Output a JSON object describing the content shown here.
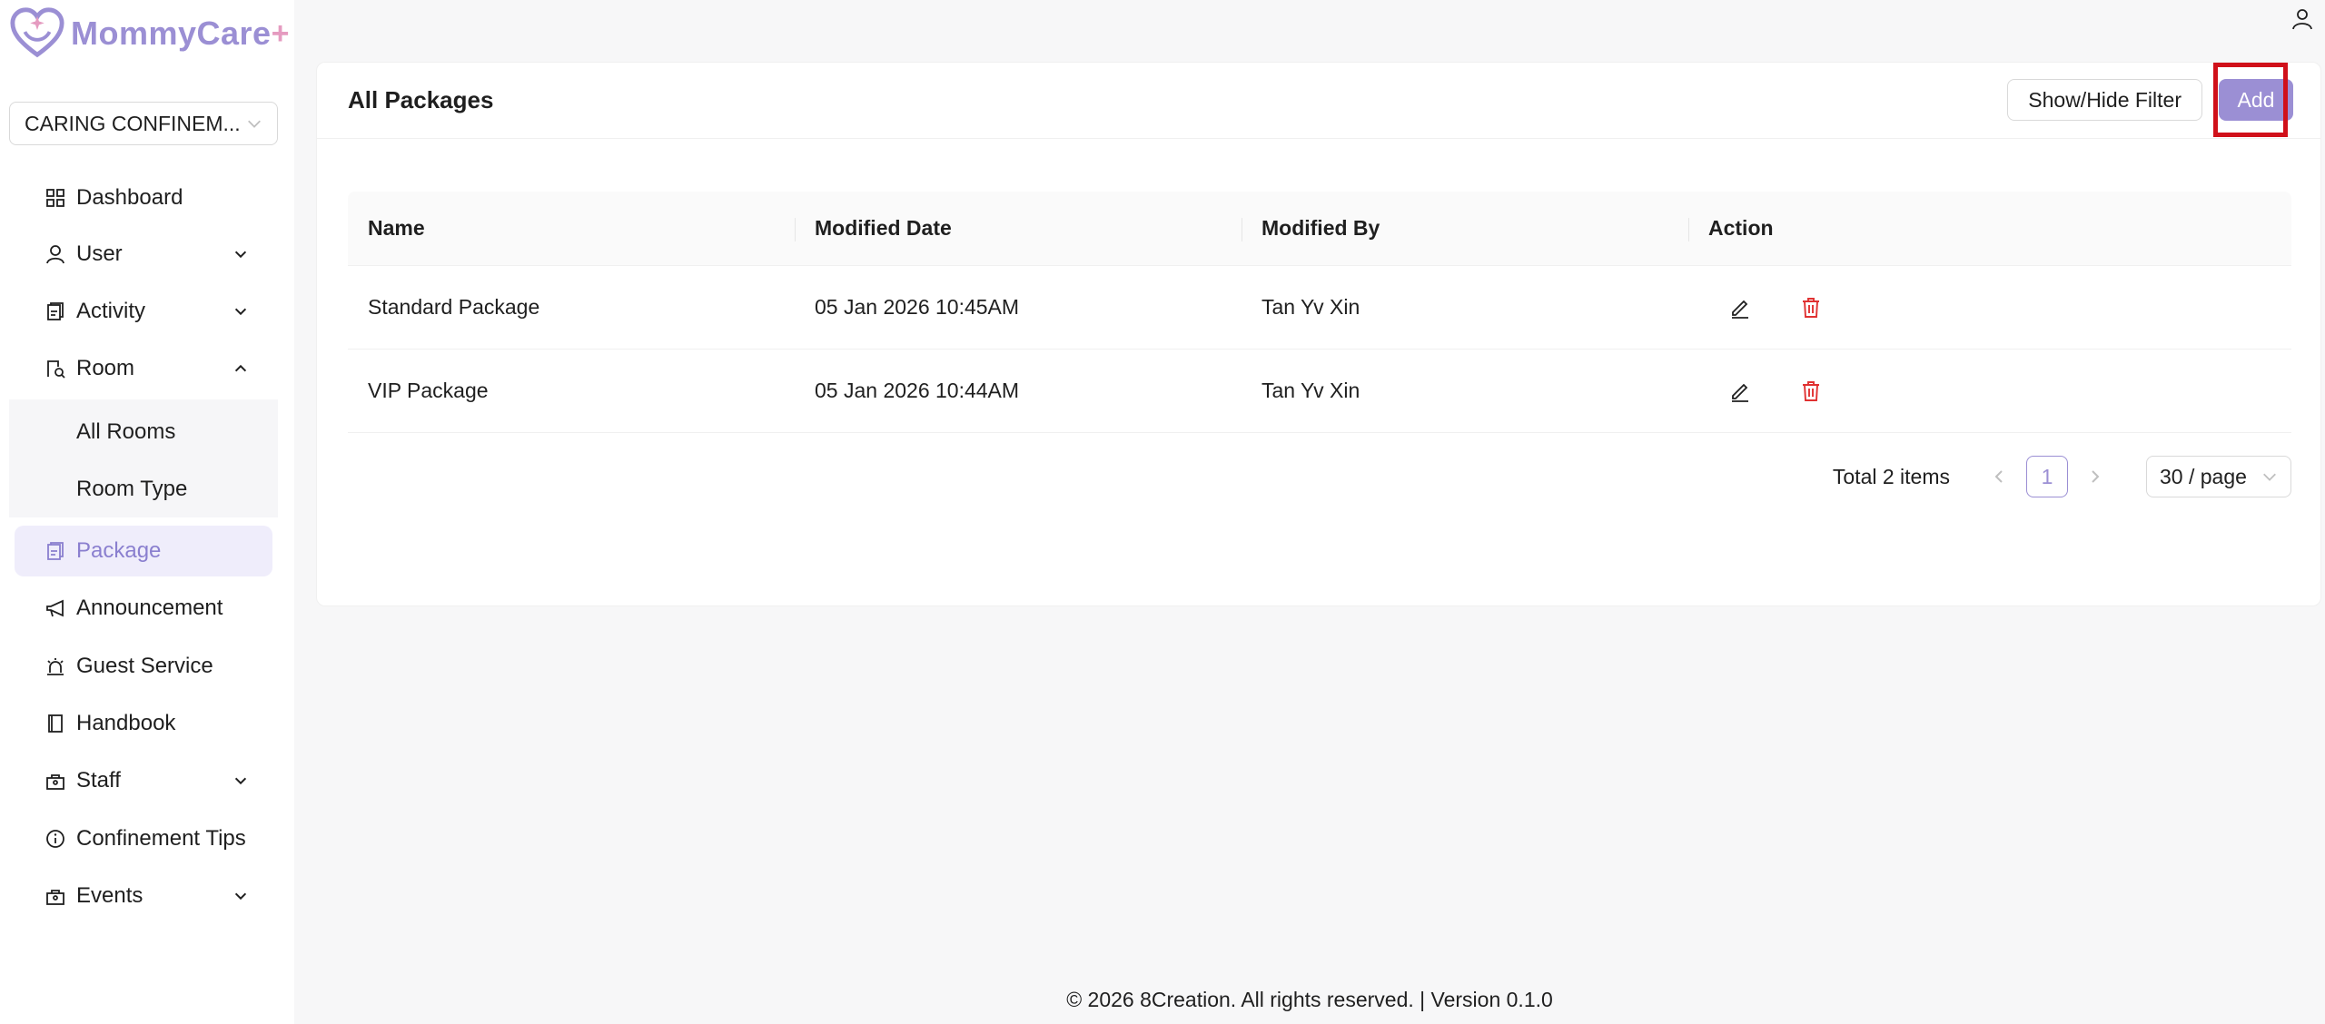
{
  "brand": {
    "name": "MommyCare",
    "plus": "+"
  },
  "org_select": {
    "value": "CARING CONFINEM..."
  },
  "sidebar": {
    "items": [
      {
        "key": "dashboard",
        "label": "Dashboard",
        "icon": "dashboard-icon"
      },
      {
        "key": "user",
        "label": "User",
        "icon": "user-icon"
      },
      {
        "key": "activity",
        "label": "Activity",
        "icon": "activity-icon"
      },
      {
        "key": "room",
        "label": "Room",
        "icon": "room-icon"
      },
      {
        "key": "package",
        "label": "Package",
        "icon": "package-icon"
      },
      {
        "key": "announcement",
        "label": "Announcement",
        "icon": "megaphone-icon"
      },
      {
        "key": "guest-service",
        "label": "Guest Service",
        "icon": "alarm-icon"
      },
      {
        "key": "handbook",
        "label": "Handbook",
        "icon": "book-icon"
      },
      {
        "key": "staff",
        "label": "Staff",
        "icon": "staff-icon"
      },
      {
        "key": "confinement-tips",
        "label": "Confinement Tips",
        "icon": "info-icon"
      },
      {
        "key": "events",
        "label": "Events",
        "icon": "events-icon"
      }
    ],
    "room_sub": [
      "All Rooms",
      "Room Type"
    ]
  },
  "page": {
    "title": "All Packages",
    "filter_label": "Show/Hide Filter",
    "add_label": "Add"
  },
  "table": {
    "headers": [
      "Name",
      "Modified Date",
      "Modified By",
      "Action"
    ],
    "rows": [
      {
        "name": "Standard Package",
        "date": "05 Jan 2026 10:45AM",
        "by": "Tan Yv Xin"
      },
      {
        "name": "VIP Package",
        "date": "05 Jan 2026 10:44AM",
        "by": "Tan Yv Xin"
      }
    ]
  },
  "pagination": {
    "total": "Total 2 items",
    "current": "1",
    "page_size": "30 / page"
  },
  "footer": "© 2026 8Creation. All rights reserved. | Version 0.1.0",
  "colors": {
    "accent": "#9b8fd4",
    "danger": "#e03131",
    "highlight": "#d0101a"
  }
}
